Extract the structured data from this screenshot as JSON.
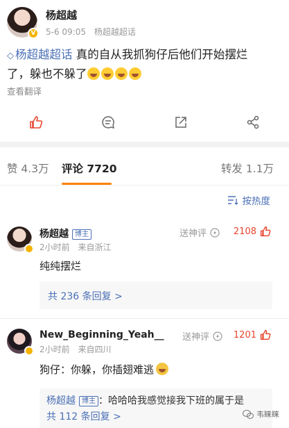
{
  "post": {
    "author": "杨超越",
    "date": "5-6 09:05",
    "source": "杨超越超话",
    "topic": "杨超越超话",
    "text_line1": " 真的自从我抓狗仔后他们开始摆烂",
    "text_line2": "了，躲也不躲了",
    "translate": "查看翻译"
  },
  "actions": {
    "like_icon": "thumbs-up-icon",
    "comment_icon": "comment-bubble-icon",
    "repost_icon": "share-arrow-icon",
    "more_icon": "share-network-icon"
  },
  "tabs": {
    "likes": "赞 4.3万",
    "comments": "评论 7720",
    "reposts": "转发 1.1万"
  },
  "sort": {
    "label": "按热度"
  },
  "comments": [
    {
      "name": "杨超越",
      "badge": "博主",
      "time": "2小时前",
      "location": "来自浙江",
      "god": "送神评",
      "likes": "2108",
      "text": "纯纯摆烂",
      "replies": "共 236 条回复 >"
    },
    {
      "name": "New_Beginning_Yeah__",
      "time": "2小时前",
      "location": "来自四川",
      "god": "送神评",
      "likes": "1201",
      "text": "狗仔：你躲，你插翅难逃",
      "reply_author": "杨超越",
      "reply_badge": "博主",
      "reply_text": "：哈哈哈我感觉接我下班的属于是",
      "replies": "共 112 条回复 >"
    }
  ],
  "watermark": "韦睐睐",
  "colors": {
    "accent": "#ff8200",
    "link": "#4a6fb5",
    "like_red": "#e8452f"
  }
}
